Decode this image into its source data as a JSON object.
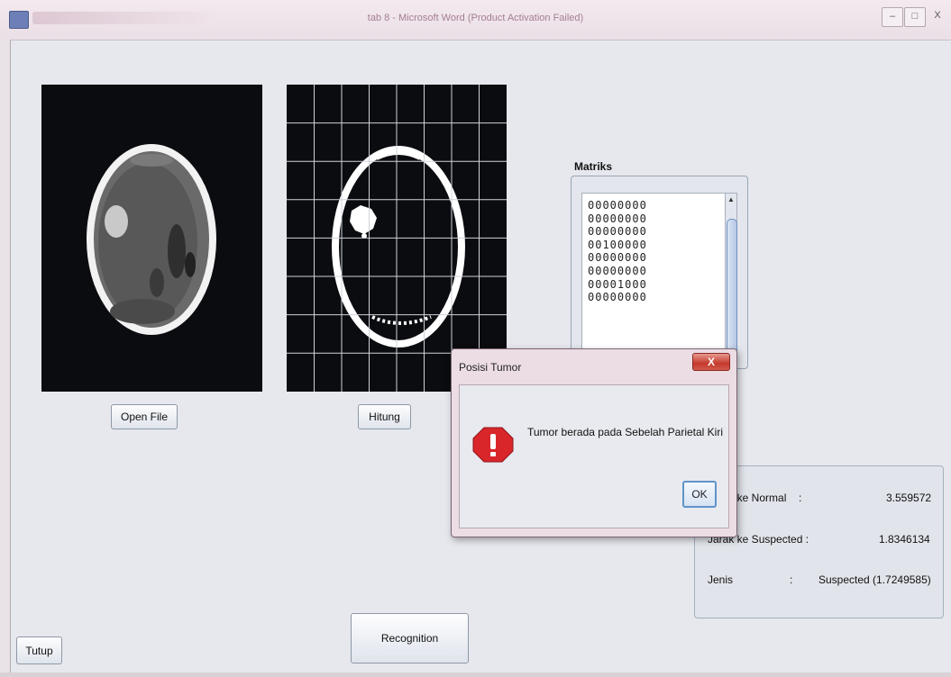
{
  "window": {
    "title": "tab 8 - Microsoft Word (Product Activation Failed)",
    "controls": {
      "minimize": "–",
      "maximize": "□",
      "close": "X"
    }
  },
  "buttons": {
    "open_file": "Open File",
    "hitung": "Hitung",
    "recognition": "Recognition",
    "tutup": "Tutup"
  },
  "matrix": {
    "label": "Matriks",
    "rows": [
      "00000000",
      "00000000",
      "00000000",
      "00100000",
      "00000000",
      "00000000",
      "00001000",
      "00000000"
    ]
  },
  "results": {
    "normal_label": "Jarak ke Normal",
    "normal_sep": ":",
    "normal_value": "3.559572",
    "suspected_label": "Jarak ke Suspected :",
    "suspected_value": "1.8346134",
    "jenis_label": "Jenis",
    "jenis_sep": ":",
    "jenis_value": "Suspected (1.7249585)"
  },
  "dialog": {
    "title": "Posisi Tumor",
    "close": "X",
    "message": "Tumor berada pada Sebelah Parietal Kiri",
    "ok": "OK"
  }
}
